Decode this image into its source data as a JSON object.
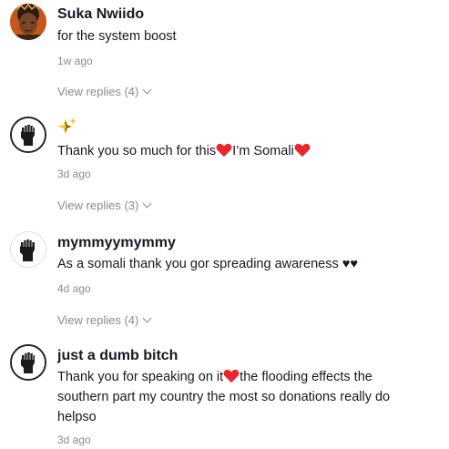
{
  "comments": [
    {
      "username": "Suka Nwiido",
      "text": "for the system boost",
      "time": "1w ago",
      "replies": "View replies (4)"
    },
    {
      "username": "",
      "emoji_line": "sparkles",
      "text_before": "Thank you so much for this",
      "text_middle": "I’m Somali",
      "time": "3d ago",
      "replies": "View replies (3)"
    },
    {
      "username": "mymmyymymmy",
      "text": "As a somali thank you gor spreading awareness ♥♥",
      "time": "4d ago",
      "replies": "View replies (4)"
    },
    {
      "username": "just a dumb bitch",
      "text_line1_before": "Thank you for speaking on it",
      "text_line1_after": "the flooding effects the",
      "text_line2": "southern part my country the most so donations really do",
      "text_line3": "helpso",
      "time": "3d ago"
    }
  ],
  "icons": {
    "heart_color": "#e8262c",
    "sparkle_color": "#f7c531",
    "fist_avatar": "raised-fist-icon"
  }
}
